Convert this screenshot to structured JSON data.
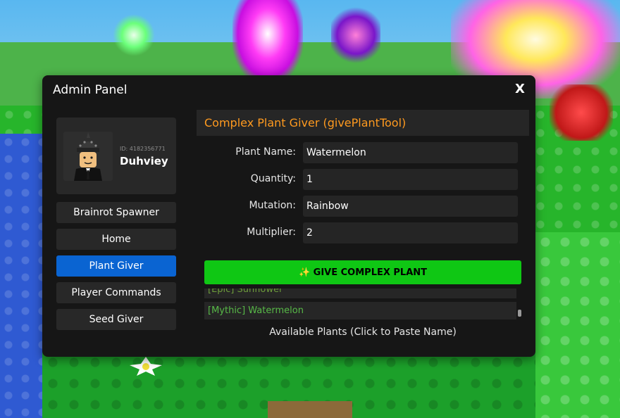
{
  "window": {
    "title": "Admin Panel",
    "close_label": "X"
  },
  "profile": {
    "user_id": "ID: 4182356771",
    "username": "Duhviey"
  },
  "sidebar": {
    "items": [
      {
        "label": "Brainrot Spawner",
        "active": false
      },
      {
        "label": "Home",
        "active": false
      },
      {
        "label": "Plant Giver",
        "active": true
      },
      {
        "label": "Player Commands",
        "active": false
      },
      {
        "label": "Seed Giver",
        "active": false
      }
    ]
  },
  "content": {
    "title": "Complex Plant Giver (givePlantTool)",
    "fields": {
      "plant_name": {
        "label": "Plant Name:",
        "value": "Watermelon"
      },
      "quantity": {
        "label": "Quantity:",
        "value": "1"
      },
      "mutation": {
        "label": "Mutation:",
        "value": "Rainbow"
      },
      "multiplier": {
        "label": "Multiplier:",
        "value": "2"
      }
    },
    "give_button": "✨ GIVE COMPLEX PLANT",
    "plants": [
      "[Epic] Sunflower",
      "[Mythic] Watermelon"
    ],
    "list_caption": "Available Plants (Click to Paste Name)"
  },
  "colors": {
    "panel_bg": "#161616",
    "accent_title": "#ff9a1f",
    "active_nav": "#0a64d2",
    "give_button": "#0fc714",
    "plant_text": "#57b947"
  },
  "icons": [
    "close-icon",
    "sparkles-icon",
    "avatar-icon"
  ]
}
